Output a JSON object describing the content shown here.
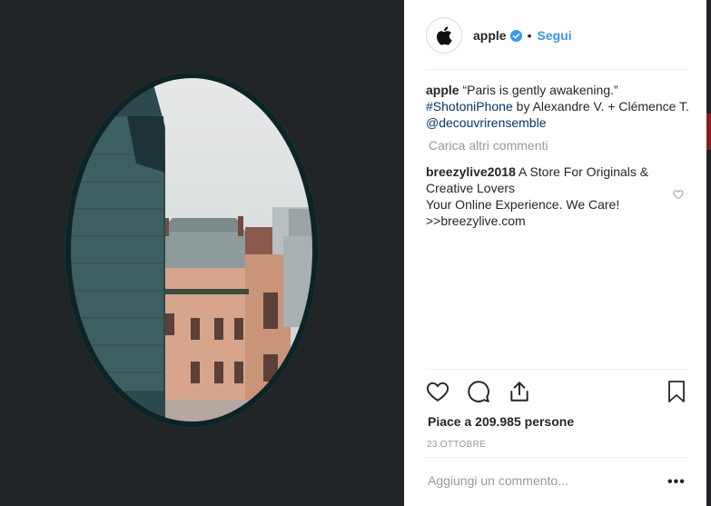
{
  "post": {
    "username": "apple",
    "follow_label": "Segui",
    "dot": "•",
    "caption": {
      "username": "apple",
      "text": "“Paris is gently awakening.”",
      "hashtag": "#ShotoniPhone",
      "text2": "by Alexandre V. + Clémence T.",
      "mention": "@decouvrirensemble"
    },
    "load_more_label": "Carica altri commenti",
    "comments": [
      {
        "username": "breezylive2018",
        "text": "A Store For Originals & Creative Lovers",
        "line2": "Your Online Experience. We Care!",
        "line3": ">>breezylive.com"
      }
    ],
    "likes_text": "Piace a 209.985 persone",
    "date": "23 OTTOBRE",
    "add_comment_placeholder": "Aggiungi un commento...",
    "more_options": "•••"
  },
  "icons": {
    "avatar": "apple-logo-icon",
    "verified": "verified-badge-icon",
    "like": "heart-icon",
    "comment": "comment-bubble-icon",
    "share": "share-icon",
    "save": "bookmark-icon",
    "comment_like": "heart-icon"
  },
  "colors": {
    "media_background": "#222528",
    "link": "#3897f0",
    "hashtag": "#003569",
    "muted": "#999999"
  }
}
